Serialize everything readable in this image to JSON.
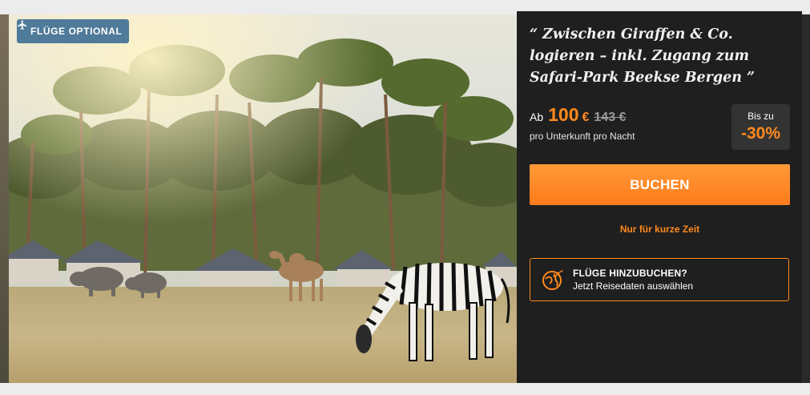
{
  "badge": {
    "icon": "airplane-icon",
    "label": "FLÜGE OPTIONAL"
  },
  "photo": {
    "subject": "zebra-giraffe-camel-rhinos-safari-park-photo"
  },
  "offer": {
    "quote": "“ Zwischen Giraffen & Co. logieren – inkl. Zugang zum Safari-Park Beekse Bergen ”",
    "price_prefix": "Ab",
    "price_amount": "100",
    "price_currency": "€",
    "price_old": "143 €",
    "price_unit": "pro Unterkunft pro Nacht",
    "discount_label": "Bis zu",
    "discount_value": "-30%",
    "book_label": "BUCHEN",
    "limited_label": "Nur für kurze Zeit",
    "flight_add_title": "FLÜGE HINZUBUCHEN?",
    "flight_add_sub": "Jetzt Reisedaten auswählen",
    "flight_add_icon": "airplane-globe-icon"
  },
  "colors": {
    "accent": "#ff8a1e",
    "panel_bg": "#1f1f1f",
    "badge_bg": "#4f7a99"
  }
}
